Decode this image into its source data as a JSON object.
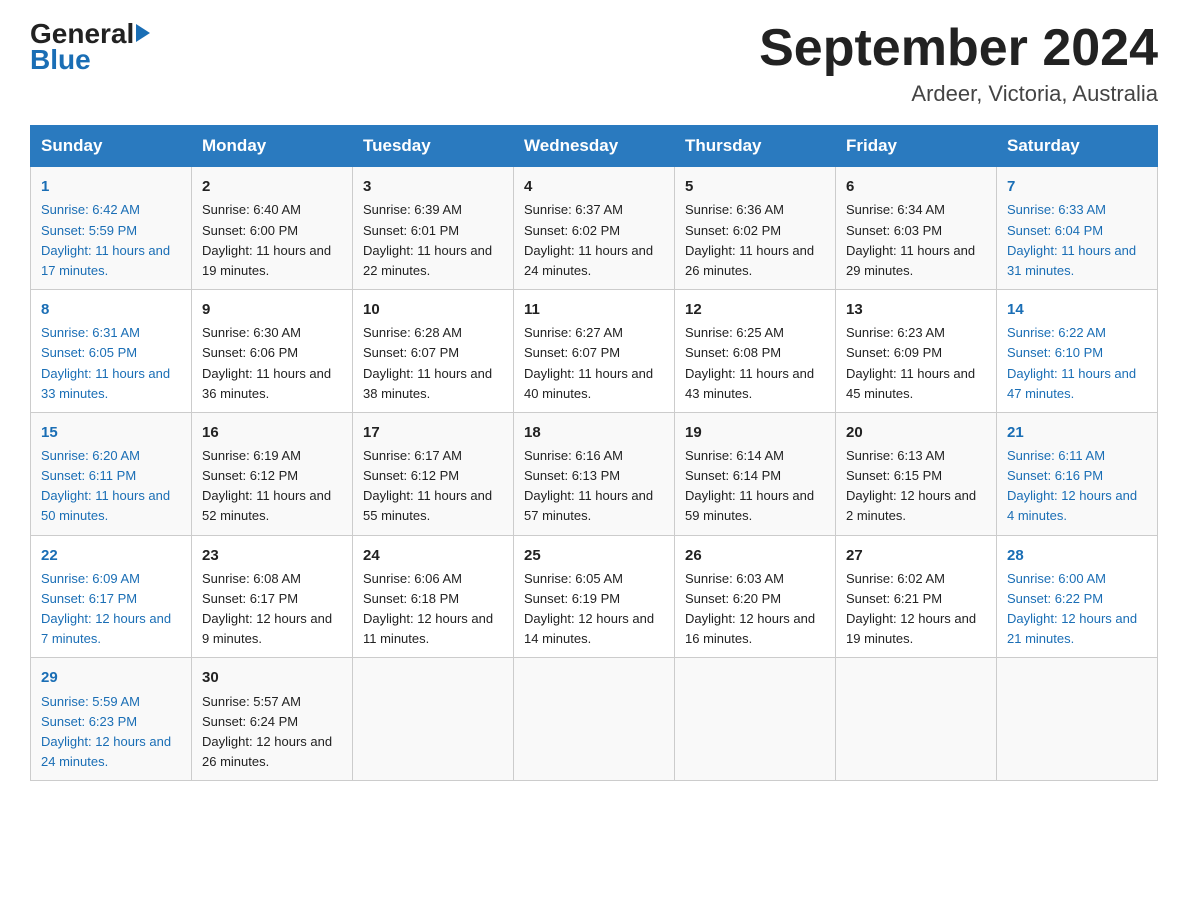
{
  "header": {
    "logo": {
      "general": "General",
      "blue": "Blue"
    },
    "title": "September 2024",
    "location": "Ardeer, Victoria, Australia"
  },
  "days_of_week": [
    "Sunday",
    "Monday",
    "Tuesday",
    "Wednesday",
    "Thursday",
    "Friday",
    "Saturday"
  ],
  "weeks": [
    [
      {
        "day": "1",
        "sunrise": "6:42 AM",
        "sunset": "5:59 PM",
        "daylight": "11 hours and 17 minutes."
      },
      {
        "day": "2",
        "sunrise": "6:40 AM",
        "sunset": "6:00 PM",
        "daylight": "11 hours and 19 minutes."
      },
      {
        "day": "3",
        "sunrise": "6:39 AM",
        "sunset": "6:01 PM",
        "daylight": "11 hours and 22 minutes."
      },
      {
        "day": "4",
        "sunrise": "6:37 AM",
        "sunset": "6:02 PM",
        "daylight": "11 hours and 24 minutes."
      },
      {
        "day": "5",
        "sunrise": "6:36 AM",
        "sunset": "6:02 PM",
        "daylight": "11 hours and 26 minutes."
      },
      {
        "day": "6",
        "sunrise": "6:34 AM",
        "sunset": "6:03 PM",
        "daylight": "11 hours and 29 minutes."
      },
      {
        "day": "7",
        "sunrise": "6:33 AM",
        "sunset": "6:04 PM",
        "daylight": "11 hours and 31 minutes."
      }
    ],
    [
      {
        "day": "8",
        "sunrise": "6:31 AM",
        "sunset": "6:05 PM",
        "daylight": "11 hours and 33 minutes."
      },
      {
        "day": "9",
        "sunrise": "6:30 AM",
        "sunset": "6:06 PM",
        "daylight": "11 hours and 36 minutes."
      },
      {
        "day": "10",
        "sunrise": "6:28 AM",
        "sunset": "6:07 PM",
        "daylight": "11 hours and 38 minutes."
      },
      {
        "day": "11",
        "sunrise": "6:27 AM",
        "sunset": "6:07 PM",
        "daylight": "11 hours and 40 minutes."
      },
      {
        "day": "12",
        "sunrise": "6:25 AM",
        "sunset": "6:08 PM",
        "daylight": "11 hours and 43 minutes."
      },
      {
        "day": "13",
        "sunrise": "6:23 AM",
        "sunset": "6:09 PM",
        "daylight": "11 hours and 45 minutes."
      },
      {
        "day": "14",
        "sunrise": "6:22 AM",
        "sunset": "6:10 PM",
        "daylight": "11 hours and 47 minutes."
      }
    ],
    [
      {
        "day": "15",
        "sunrise": "6:20 AM",
        "sunset": "6:11 PM",
        "daylight": "11 hours and 50 minutes."
      },
      {
        "day": "16",
        "sunrise": "6:19 AM",
        "sunset": "6:12 PM",
        "daylight": "11 hours and 52 minutes."
      },
      {
        "day": "17",
        "sunrise": "6:17 AM",
        "sunset": "6:12 PM",
        "daylight": "11 hours and 55 minutes."
      },
      {
        "day": "18",
        "sunrise": "6:16 AM",
        "sunset": "6:13 PM",
        "daylight": "11 hours and 57 minutes."
      },
      {
        "day": "19",
        "sunrise": "6:14 AM",
        "sunset": "6:14 PM",
        "daylight": "11 hours and 59 minutes."
      },
      {
        "day": "20",
        "sunrise": "6:13 AM",
        "sunset": "6:15 PM",
        "daylight": "12 hours and 2 minutes."
      },
      {
        "day": "21",
        "sunrise": "6:11 AM",
        "sunset": "6:16 PM",
        "daylight": "12 hours and 4 minutes."
      }
    ],
    [
      {
        "day": "22",
        "sunrise": "6:09 AM",
        "sunset": "6:17 PM",
        "daylight": "12 hours and 7 minutes."
      },
      {
        "day": "23",
        "sunrise": "6:08 AM",
        "sunset": "6:17 PM",
        "daylight": "12 hours and 9 minutes."
      },
      {
        "day": "24",
        "sunrise": "6:06 AM",
        "sunset": "6:18 PM",
        "daylight": "12 hours and 11 minutes."
      },
      {
        "day": "25",
        "sunrise": "6:05 AM",
        "sunset": "6:19 PM",
        "daylight": "12 hours and 14 minutes."
      },
      {
        "day": "26",
        "sunrise": "6:03 AM",
        "sunset": "6:20 PM",
        "daylight": "12 hours and 16 minutes."
      },
      {
        "day": "27",
        "sunrise": "6:02 AM",
        "sunset": "6:21 PM",
        "daylight": "12 hours and 19 minutes."
      },
      {
        "day": "28",
        "sunrise": "6:00 AM",
        "sunset": "6:22 PM",
        "daylight": "12 hours and 21 minutes."
      }
    ],
    [
      {
        "day": "29",
        "sunrise": "5:59 AM",
        "sunset": "6:23 PM",
        "daylight": "12 hours and 24 minutes."
      },
      {
        "day": "30",
        "sunrise": "5:57 AM",
        "sunset": "6:24 PM",
        "daylight": "12 hours and 26 minutes."
      },
      {
        "day": "",
        "sunrise": "",
        "sunset": "",
        "daylight": ""
      },
      {
        "day": "",
        "sunrise": "",
        "sunset": "",
        "daylight": ""
      },
      {
        "day": "",
        "sunrise": "",
        "sunset": "",
        "daylight": ""
      },
      {
        "day": "",
        "sunrise": "",
        "sunset": "",
        "daylight": ""
      },
      {
        "day": "",
        "sunrise": "",
        "sunset": "",
        "daylight": ""
      }
    ]
  ],
  "labels": {
    "sunrise_prefix": "Sunrise: ",
    "sunset_prefix": "Sunset: ",
    "daylight_prefix": "Daylight: "
  }
}
